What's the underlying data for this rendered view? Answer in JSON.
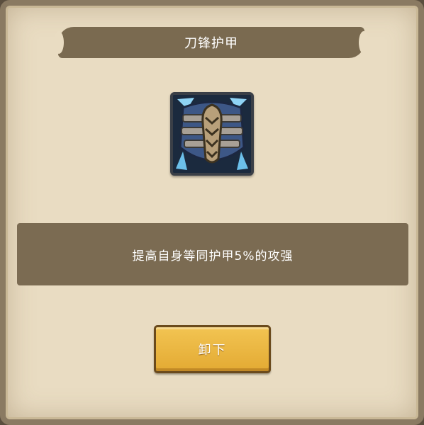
{
  "dialog": {
    "title": "刀锋护甲",
    "item_icon": "blade-armor-icon",
    "description": "提高自身等同护甲5%的攻强",
    "unequip_label": "卸下"
  },
  "colors": {
    "panel_bg": "#e9dcc2",
    "banner_bg": "#7a6a50",
    "button_bg": "#e8b23b"
  }
}
